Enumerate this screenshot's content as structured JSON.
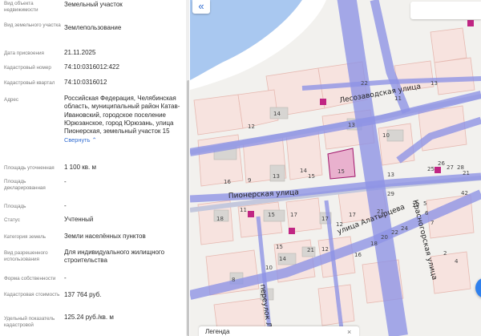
{
  "panel": {
    "rows": [
      {
        "label": "Вид объекта недвижимости",
        "value": "Земельный участок"
      },
      {
        "label": "Вид земельного участка",
        "value": "Землепользование"
      },
      {
        "label": "Дата присвоения",
        "value": "21.11.2025"
      },
      {
        "label": "Кадастровый номер",
        "value": "74:10:0316012:422"
      },
      {
        "label": "Кадастровый квартал",
        "value": "74:10:0316012"
      },
      {
        "label": "Адрес",
        "value": "Российская Федерация, Челябинская область, муниципальный район Катав-Ивановский, городское поселение Юрюзанское, город Юрюзань, улица Пионерская, земельный участок 15",
        "link": "Свернуть"
      },
      {
        "label": "Площадь уточненная",
        "value": "1 100 кв. м"
      },
      {
        "label": "Площадь декларированная",
        "value": "-"
      },
      {
        "label": "Площадь",
        "value": "-"
      },
      {
        "label": "Статус",
        "value": "Учтенный"
      },
      {
        "label": "Категория земель",
        "value": "Земли населённых пунктов"
      },
      {
        "label": "Вид разрешенного использования",
        "value": "Для индивидуального жилищного строительства"
      },
      {
        "label": "Форма собственности",
        "value": "-"
      },
      {
        "label": "Кадастровая стоимость",
        "value": "137 764 руб."
      },
      {
        "label": "Удельный показатель кадастровой",
        "value": "125.24 руб./кв. м"
      }
    ]
  },
  "map": {
    "collapse_icon": "«",
    "legend_label": "Легенда",
    "legend_close": "×",
    "streets": {
      "lesozavodskaya": "Лесозаводская улица",
      "pionerskaya": "Пионерская улица",
      "alatortseva": "улица Алатырцева",
      "krasnogorskaya": "Красногорская улица",
      "pereulok": "переулок Ли"
    },
    "numbers": [
      "22",
      "13",
      "14",
      "12",
      "13",
      "11",
      "10",
      "15",
      "9",
      "13",
      "15",
      "17",
      "11",
      "16",
      "15",
      "17",
      "12",
      "29",
      "28",
      "27",
      "26",
      "25",
      "18",
      "21",
      "19",
      "17",
      "12",
      "16",
      "18",
      "20",
      "22",
      "24",
      "14",
      "10",
      "8",
      "21",
      "13",
      "14",
      "5",
      "6",
      "7",
      "2",
      "4",
      "15",
      "42",
      "21"
    ]
  }
}
